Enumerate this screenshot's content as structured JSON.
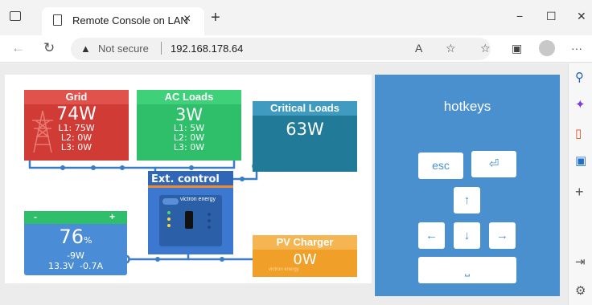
{
  "browser": {
    "tab_title": "Remote Console on LAN",
    "tab_close": "×",
    "new_tab": "+",
    "minimize": "−",
    "maximize": "☐",
    "close": "✕",
    "back": "←",
    "reload": "↻",
    "security_label": "Not secure",
    "url": "192.168.178.64",
    "more": "···"
  },
  "console": {
    "grid": {
      "title": "Grid",
      "power": "74W",
      "l1": "L1: 75W",
      "l2": "L2: 0W",
      "l3": "L3: 0W"
    },
    "ac_loads": {
      "title": "AC Loads",
      "power": "3W",
      "l1": "L1: 5W",
      "l2": "L2: 0W",
      "l3": "L3: 0W"
    },
    "critical_loads": {
      "title": "Critical Loads",
      "power": "63W"
    },
    "ext_control": {
      "title": "Ext. control",
      "brand": "victron energy"
    },
    "battery": {
      "soc": "76",
      "soc_unit": "%",
      "power": "-9W",
      "voltage": "13.3V",
      "current": "-0.7A",
      "minus": "-",
      "plus": "+"
    },
    "pv_charger": {
      "title": "PV Charger",
      "power": "0W",
      "brand": "victron energy"
    }
  },
  "hotkeys": {
    "title": "hotkeys",
    "esc": "esc",
    "enter": "⏎",
    "up": "↑",
    "left": "←",
    "down": "↓",
    "right": "→",
    "space": "⎵"
  },
  "colors": {
    "grid": "#d13b35",
    "ac_loads": "#2fbf6a",
    "critical": "#207a98",
    "critical_head": "#3f9bbf",
    "ext_control": "#3c78cf",
    "battery": "#4a8cd6",
    "battery_head": "#2fbf6a",
    "pv": "#f0a028",
    "hotkeys_bg": "#4a90cf",
    "wire": "#3a7cc6"
  }
}
